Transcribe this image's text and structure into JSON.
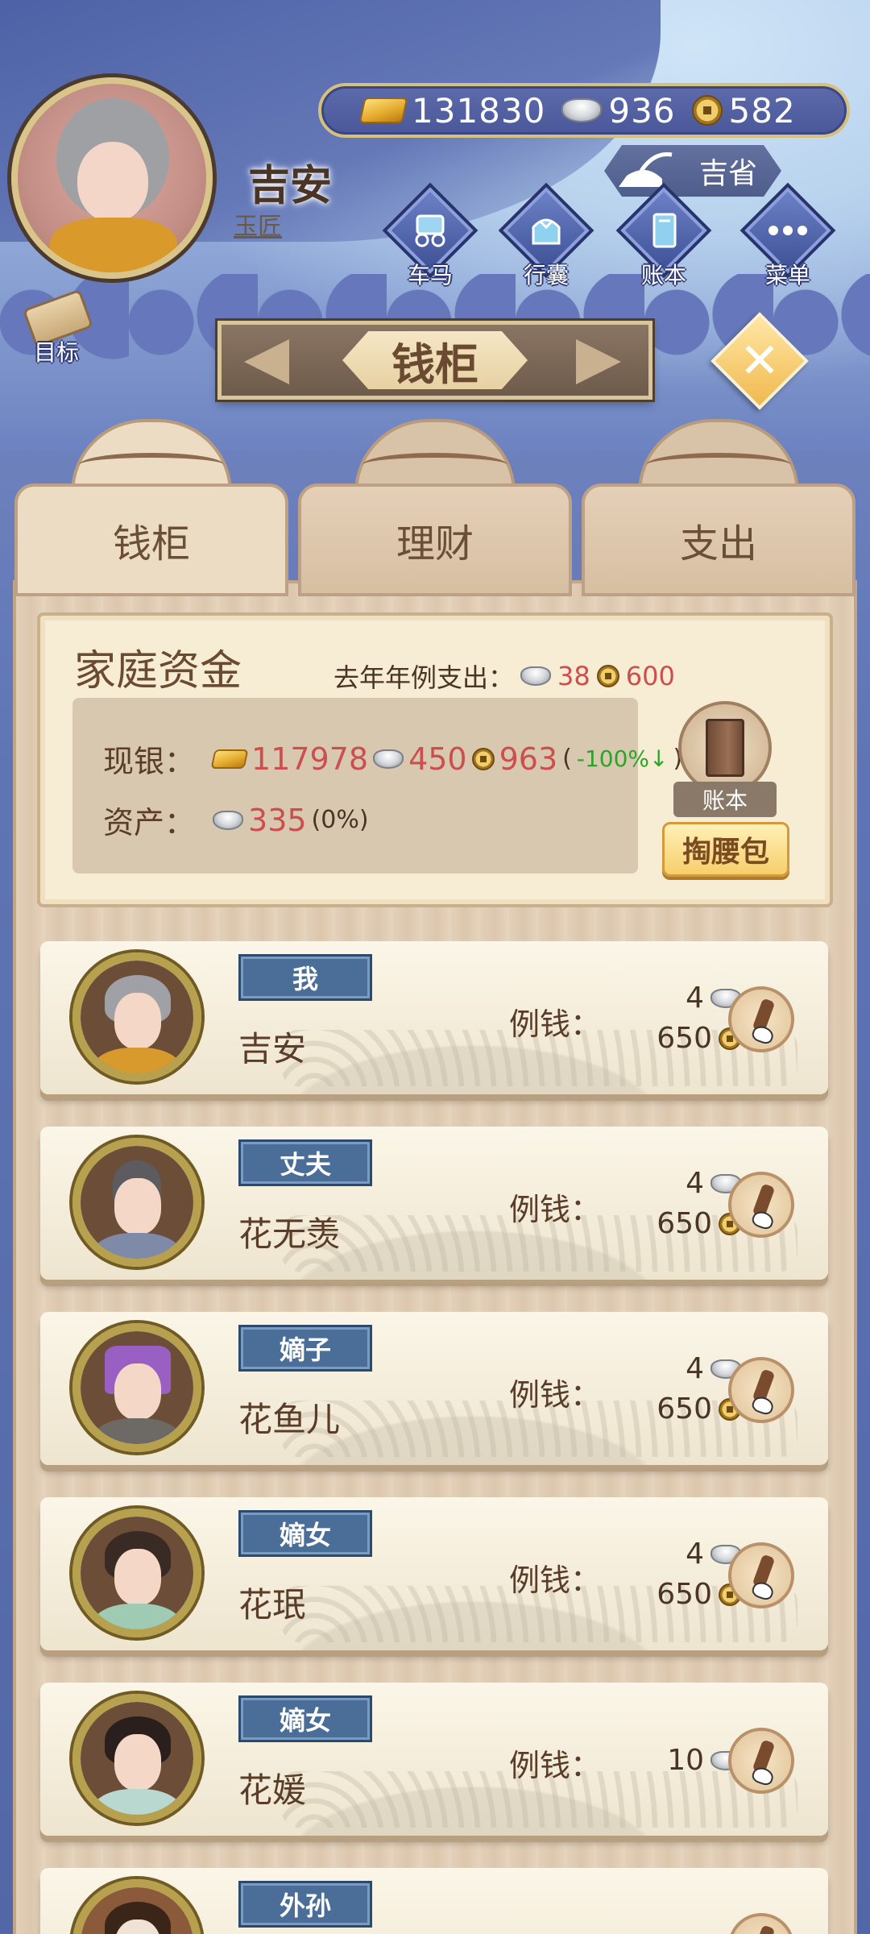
{
  "header": {
    "player_name": "吉安",
    "player_title": "玉匠",
    "resources": {
      "gold": "131830",
      "silver": "936",
      "copper": "582"
    },
    "region": "吉省",
    "nav": [
      {
        "label": "车马",
        "icon": "carriage-icon"
      },
      {
        "label": "行囊",
        "icon": "bundle-icon"
      },
      {
        "label": "账本",
        "icon": "ledger-icon"
      },
      {
        "label": "菜单",
        "icon": "more-icon"
      }
    ],
    "goal_label": "目标"
  },
  "page_title": "钱柜",
  "tabs": [
    {
      "label": "钱柜",
      "active": true
    },
    {
      "label": "理财",
      "active": false
    },
    {
      "label": "支出",
      "active": false
    }
  ],
  "family_funds": {
    "title": "家庭资金",
    "last_year_label": "去年年例支出：",
    "last_year_silver": "38",
    "last_year_copper": "600",
    "cash_label": "现银：",
    "cash_gold": "117978",
    "cash_silver": "450",
    "cash_copper": "963",
    "cash_change_open": "(",
    "cash_change": "-100%↓",
    "cash_change_close": ")",
    "assets_label": "资产：",
    "assets_silver": "335",
    "assets_change": "(0%)",
    "ledger_label": "账本",
    "purse_button": "掏腰包"
  },
  "stipend_label": "例钱：",
  "members": [
    {
      "role": "我",
      "name": "吉安",
      "silver": "4",
      "copper": "650"
    },
    {
      "role": "丈夫",
      "name": "花无羡",
      "silver": "4",
      "copper": "650"
    },
    {
      "role": "嫡子",
      "name": "花鱼儿",
      "silver": "4",
      "copper": "650"
    },
    {
      "role": "嫡女",
      "name": "花珉",
      "silver": "4",
      "copper": "650"
    },
    {
      "role": "嫡女",
      "name": "花媛",
      "silver": "10",
      "copper": null
    },
    {
      "role": "外孙",
      "name": "",
      "silver": null,
      "copper": null
    }
  ],
  "colors": {
    "accent_red": "#cd4e4e",
    "change_green": "#2aa52a",
    "role_badge": "#4a6e97",
    "nav_blue": "#3c4f95"
  }
}
